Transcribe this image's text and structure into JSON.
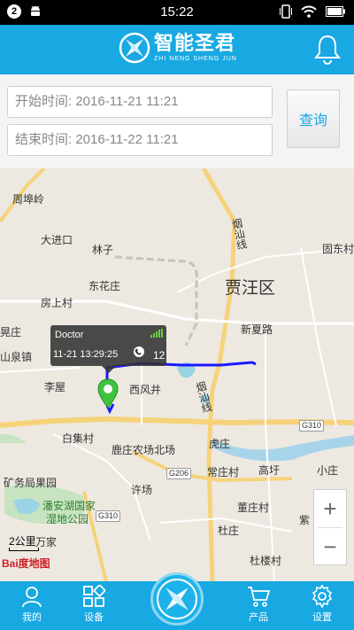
{
  "status_bar": {
    "notification_count": "2",
    "time": "15:22",
    "battery_icon": "battery-icon",
    "wifi_icon": "wifi-icon",
    "vibrate_icon": "vibrate-icon"
  },
  "header": {
    "logo_text": "智能圣君",
    "logo_subtext": "ZHI NENG SHENG JUN",
    "bell_icon": "bell-icon"
  },
  "query": {
    "start_label": "开始时间: 2016-11-21 11:21",
    "end_label": "结束时间: 2016-11-22 11:21",
    "submit_label": "查询"
  },
  "map": {
    "labels": {
      "zhoufuling": "周埠岭",
      "dajinkou": "大进口",
      "linzi": "林子",
      "dongyoukong": "固东村",
      "donghuazhuang": "东花庄",
      "fangshangcun": "房上村",
      "jiawang": "贾汪区",
      "xinxialu": "新夏路",
      "huangzhuang": "晃庄",
      "shanquanzhen": "山泉镇",
      "liwu": "李屋",
      "xifengjing": "西风井",
      "baijicun": "白集村",
      "luzhuangcun": "鹿庄农场北场",
      "hongzhuang": "虎庄",
      "changzhuangcun": "常庄村",
      "gaoyu": "高圩",
      "xiaozhuang": "小庄",
      "kuangwuju": "矿务局果园",
      "xuchang": "许场",
      "pananhu": "潘安湖国家",
      "shidi": "湿地公园",
      "dongzhuangcun": "董庄村",
      "zi": "紫",
      "wanjia": "万家",
      "duzhuang": "杜庄",
      "dulou": "杜楼村",
      "yanshan_line_1": "烟汕线",
      "yanshan_line_2": "烟汕线"
    },
    "shields": {
      "g310a": "G310",
      "g310b": "G310",
      "g206": "G206"
    },
    "popup": {
      "device_name": "Doctor",
      "timestamp": "11-21 13:29:25",
      "number": "12"
    },
    "zoom_in": "+",
    "zoom_out": "−",
    "scale_text": "2公里",
    "watermark": "Bai度地图"
  },
  "nav": {
    "items": [
      {
        "label": "我的",
        "icon": "user-icon"
      },
      {
        "label": "设备",
        "icon": "grid-icon"
      },
      {
        "label": "产品",
        "icon": "cart-icon"
      },
      {
        "label": "设置",
        "icon": "gear-icon"
      }
    ],
    "center_icon": "compass-icon"
  },
  "colors": {
    "primary": "#18a8e2",
    "track": "#1a1aff",
    "marker": "#3ec43e"
  }
}
